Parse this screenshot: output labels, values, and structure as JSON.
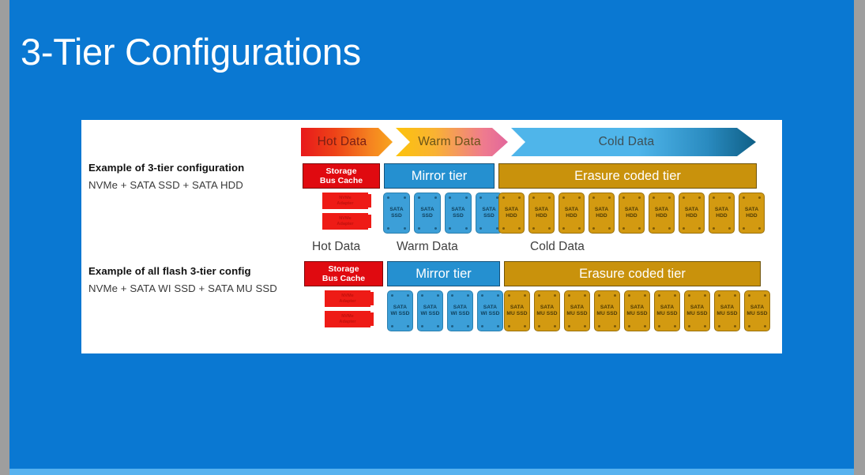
{
  "slide": {
    "title": "3-Tier Configurations",
    "background_color": "#0a78d2",
    "panel_color": "#ffffff"
  },
  "banner": {
    "segments": [
      {
        "label": "Hot Data",
        "from": "#e8191b",
        "to": "#f8a41d"
      },
      {
        "label": "Warm Data",
        "from": "#fcc30b",
        "to": "#e2679c"
      },
      {
        "label": "Cold Data",
        "from": "#4fb5ea",
        "to": "#0f5f86"
      }
    ]
  },
  "rows": [
    {
      "title": "Example of 3-tier configuration",
      "subtitle": "NVMe + SATA SSD + SATA HDD",
      "tiers": {
        "cache": "Storage\nBus Cache",
        "cache_line1": "Storage",
        "cache_line2": "Bus Cache",
        "mirror": "Mirror tier",
        "erasure": "Erasure coded tier"
      },
      "nvme": [
        {
          "line1": "NVMe",
          "line2": "Adapter"
        },
        {
          "line1": "NVMe",
          "line2": "Adapter"
        }
      ],
      "warm_drives": {
        "count": 4,
        "line1": "SATA",
        "line2": "SSD",
        "color": "#3c9fd8"
      },
      "cold_drives": {
        "count": 9,
        "line1": "SATA",
        "line2": "HDD",
        "color": "#d39a11"
      },
      "captions": {
        "hot": "Hot Data",
        "warm": "Warm Data",
        "cold": "Cold Data"
      }
    },
    {
      "title": "Example of all flash 3-tier config",
      "subtitle": "NVMe + SATA WI SSD + SATA MU SSD",
      "tiers": {
        "cache_line1": "Storage",
        "cache_line2": "Bus Cache",
        "mirror": "Mirror tier",
        "erasure": "Erasure coded tier"
      },
      "nvme": [
        {
          "line1": "NVMe",
          "line2": "Adapter"
        },
        {
          "line1": "NVMe",
          "line2": "Adapter"
        }
      ],
      "warm_drives": {
        "count": 4,
        "line1": "SATA",
        "line2": "WI SSD",
        "color": "#3c9fd8"
      },
      "cold_drives": {
        "count": 9,
        "line1": "SATA",
        "line2": "MU SSD",
        "color": "#d39a11"
      }
    }
  ],
  "colors": {
    "cache_red": "#e00a10",
    "mirror_blue": "#2590d0",
    "erasure_gold": "#c9920c",
    "slide_blue": "#0a78d2",
    "gutter_gray": "#9e9e9e"
  }
}
